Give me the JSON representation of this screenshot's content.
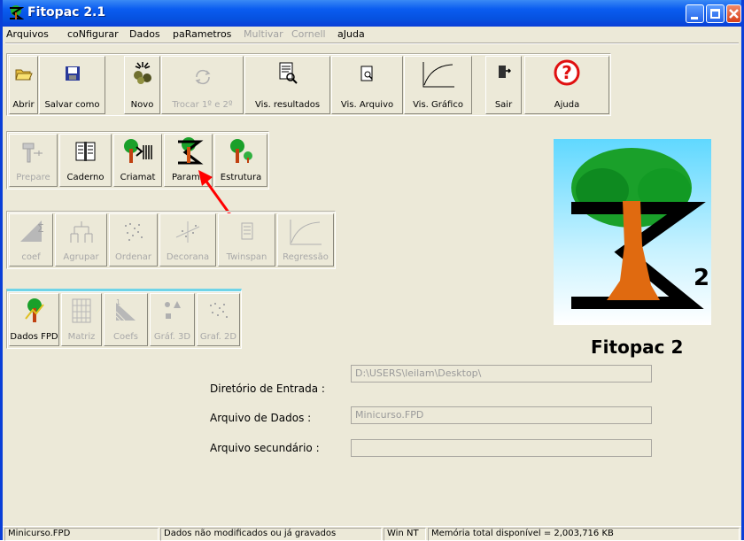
{
  "window": {
    "title": "Fitopac 2.1"
  },
  "menu": [
    {
      "label": "Arquivos",
      "enabled": true
    },
    {
      "label": "coNfigurar",
      "enabled": true
    },
    {
      "label": "Dados",
      "enabled": true
    },
    {
      "label": "paRametros",
      "enabled": true
    },
    {
      "label": "Multivar",
      "enabled": false
    },
    {
      "label": "Cornell",
      "enabled": false
    },
    {
      "label": "aJuda",
      "enabled": true
    }
  ],
  "toolbar": {
    "abrir": "Abrir",
    "salvar": "Salvar como",
    "novo": "Novo",
    "trocar": "Trocar 1º e 2º",
    "vis_resultados": "Vis. resultados",
    "vis_arquivo": "Vis. Arquivo",
    "vis_grafico": "Vis. Gráfico",
    "sair": "Sair",
    "ajuda": "Ajuda"
  },
  "group1": {
    "prepare": "Prepare",
    "caderno": "Caderno",
    "criamat": "Criamat",
    "params": "Params",
    "estrutura": "Estrutura"
  },
  "group2": {
    "coef": "coef",
    "agrupar": "Agrupar",
    "ordenar": "Ordenar",
    "decorana": "Decorana",
    "twinspan": "Twinspan",
    "regressao": "Regressão"
  },
  "group3": {
    "dados_fpd": "Dados FPD",
    "matriz": "Matriz",
    "coefs": "Coefs",
    "graf3d": "Gráf. 3D",
    "graf2d": "Graf. 2D"
  },
  "fields": {
    "diretorio_label": "Diretório de Entrada :",
    "diretorio_value": "D:\\USERS\\leilam\\Desktop\\",
    "arquivo_label": "Arquivo de Dados :",
    "arquivo_value": "Minicurso.FPD",
    "secundario_label": "Arquivo secundário :",
    "secundario_value": ""
  },
  "logo": {
    "text": "Fitopac 2",
    "superscript": "2"
  },
  "status": {
    "file": "Minicurso.FPD",
    "state": "Dados não modificados ou já gravados",
    "os": "Win NT",
    "memory": "Memória total disponível = 2,003,716 KB"
  },
  "colors": {
    "titlebar": "#0a5cf0",
    "arrow": "#ff0000",
    "sky": "#60d8ff",
    "tree_green": "#1aa02a",
    "trunk": "#e06a10"
  }
}
